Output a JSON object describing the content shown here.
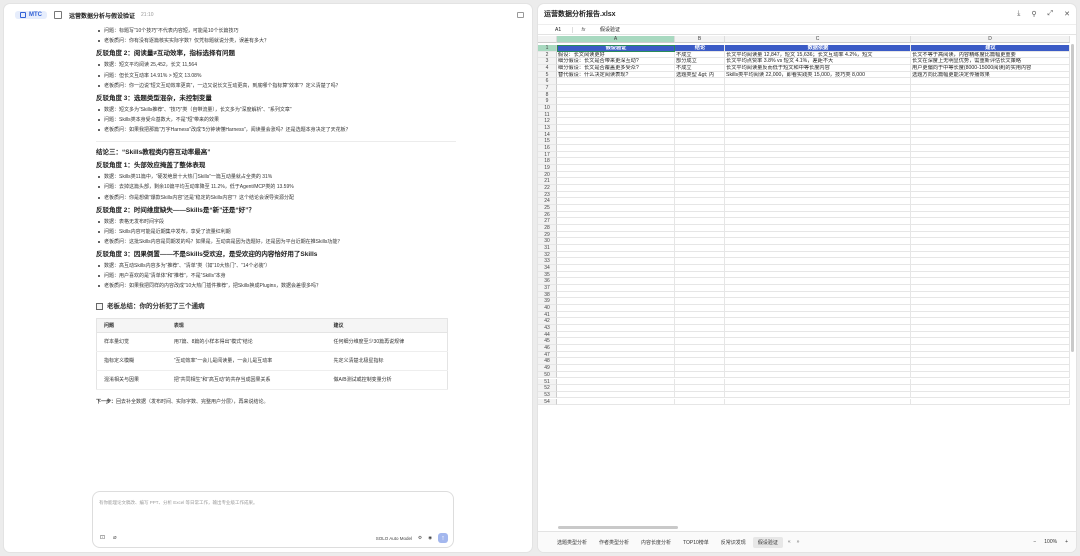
{
  "chat": {
    "badge": "MTC",
    "title": "运营数据分析与假设验证",
    "time": "21:10",
    "lines_top": [
      "问题：标题写“10个技巧”不代表内容短，可能是10个长篇技巧",
      "老板质问：你有没有逐篇核实实际字数？仅凭标题就说分类，误差有多大？"
    ],
    "sec2": {
      "title": "反驳角度 2：阅读量≠互动效率，指标选择有问题",
      "items": [
        "数据：短文平均阅读 25,452，长文 11,564",
        "问题：但长文互动率 14.91% > 短文 13.08%",
        "老板质问：你一边说“短文互动效率更高”，一边又说长文互动更高，到底哪个指标算“效率”？定义清楚了吗？"
      ]
    },
    "sec3": {
      "title": "反驳角度 3：选题类型混杂，未控制变量",
      "items": [
        "数据：短文多为“Skills推荐”、“技巧”类（自带流量），长文多为“深度解析”、“系列文章”",
        "问题：Skills类本身受众基数大，不是“短”带来的效果",
        "老板质问：如果我把那篇“万字Harness”改成“5分钟读懂Harness”，阅读量会涨吗？还是选题本身决定了天花板？"
      ]
    },
    "conc2": "结论三：“Skills教程类内容互动率最高”",
    "sec4": {
      "title": "反驳角度 1：头部效应掩盖了整体表现",
      "items": [
        "数据：Skills类11篇中，“硬发绝景十大热门Skills”一篇互动量就占全类的 31%",
        "问题：去掉这篇头部，剩余10篇平均互动率降至 11.2%，低于Agent/MCP类的 13.59%",
        "老板质问：你是想做“爆款Skills内容”还是“稳定的Skills内容”？这个结论会误导资源分配"
      ]
    },
    "sec5": {
      "title": "反驳角度 2：时间维度缺失——Skills是“新”还是“好”？",
      "items": [
        "数据：表格无发布时间字段",
        "问题：Skills内容可能是近期集中发布，享受了流量红利期",
        "老板质问：这批Skills内容是同期发的吗？如果是，互动高是因为选题好，还是因为平台近期在推Skills功能？"
      ]
    },
    "sec6": {
      "title": "反驳角度 3：因果倒置——不是Skills受欢迎，是受欢迎的内容恰好用了Skills",
      "items": [
        "数据：高互动Skills内容多为“推荐”、“清单”类（如“10大热门”、“14个必装”）",
        "问题：用户喜欢的是“清单体”和“推荐”，不是“Skills”本身",
        "老板质问：如果我把同样的内容改成“10大热门插件推荐”，把Skills换成Plugins，数据会差很多吗？"
      ]
    },
    "summary_title": "老板总结：你的分析犯了三个通病",
    "table": {
      "headers": [
        "问题",
        "表现",
        "建议"
      ],
      "rows": [
        [
          "样本量幻觉",
          "用7篇、8篇的小样本得出“模式”结论",
          "任何细分维度至少30篇再说规律"
        ],
        [
          "指标定义模糊",
          "“互动效率”一会儿是阅读量，一会儿是互动率",
          "先定义清楚北极星指标"
        ],
        [
          "混淆相关与因果",
          "把“共同相生”和“高互动”的共存当成因果关系",
          "做A/B测试或控制变量分析"
        ]
      ]
    },
    "next_label": "下一步：",
    "next_text": "回去补全数据（发布时间、实际字数、完整用户分层），再来说结论。",
    "input_placeholder": "有你能理论文稿改、编写 PPT、分析 Excel 等日常工作，输出专业级工作成果。",
    "model_label": "SOLO Auto Model"
  },
  "sheet": {
    "title": "运营数据分析报告.xlsx",
    "cell_ref": "A1",
    "fx": "fx",
    "formula": "假设验证",
    "columns": [
      "A",
      "B",
      "C",
      "D"
    ],
    "header_row": [
      "假设验证",
      "结论",
      "数据依据",
      "建议"
    ],
    "rows": [
      [
        "假设：长文阅读更好",
        "不成立",
        "长文平均阅读量 12,847，短文 15,636；长文互动率 4.2%，短文",
        "长文不等于高阅读，内容精练度比篇幅更重要"
      ],
      [
        "细分假设：长文是否带来更深互动?",
        "部分成立",
        "长文平均点赞率 3.8% vs 短文 4.1%，差距不大",
        "长文在深度上无明显优势，需重新评估长文策略"
      ],
      [
        "细分假设：长文是否覆盖更多受众?",
        "不成立",
        "长文平均阅读量反而低于短文和中等长度内容",
        "用户更偏向于中等长度(8000-15000阅读)的实用内容"
      ],
      [
        "替代假设：什么决定阅读表现?",
        "选题类型 &gt; 内",
        "Skills类平均阅读 22,000，即看实践类 15,000，技巧类 8,000",
        "选题方向比篇幅更能决定传播效果"
      ]
    ],
    "row_count": 54,
    "tabs": [
      "选题类型分析",
      "作者类型分析",
      "内容长度分析",
      "TOP10榜单",
      "反常识发现",
      "假设验证"
    ],
    "active_tab": "假设验证",
    "zoom": "100%"
  }
}
